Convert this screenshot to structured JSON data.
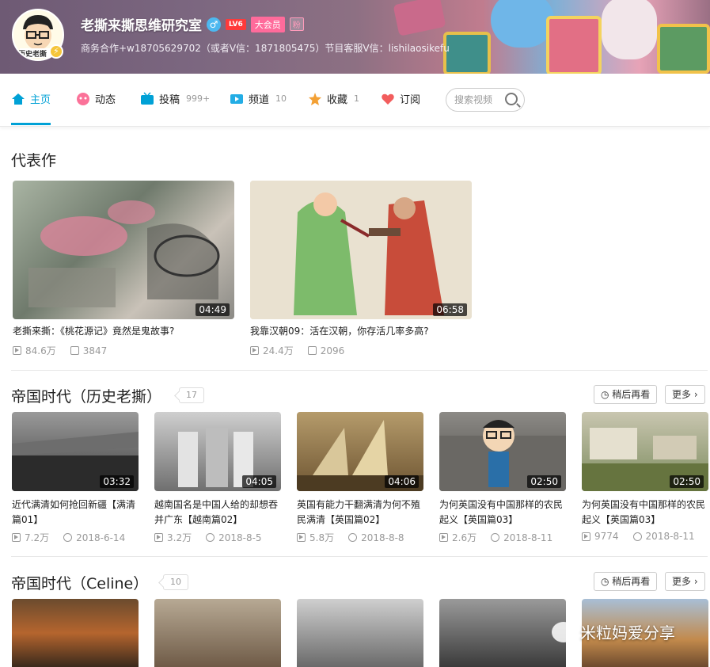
{
  "header": {
    "username": "老撕来撕思维研究室",
    "gender_glyph": "♂",
    "level": "LV6",
    "vip": "大会员",
    "fan_badge": "粉",
    "avatar_caption": "历史老撕",
    "signature": "商务合作+w18705629702（或者V信：1871805475）节目客服V信：lishilaosikefu"
  },
  "nav": {
    "items": [
      {
        "label": "主页",
        "count": "",
        "icon": "home-icon",
        "active": true
      },
      {
        "label": "动态",
        "count": "",
        "icon": "dynamic-icon"
      },
      {
        "label": "投稿",
        "count": "999+",
        "icon": "tv-icon"
      },
      {
        "label": "频道",
        "count": "10",
        "icon": "channel-icon"
      },
      {
        "label": "收藏",
        "count": "1",
        "icon": "star-icon"
      },
      {
        "label": "订阅",
        "count": "",
        "icon": "heart-icon"
      }
    ],
    "search_placeholder": "搜索视频"
  },
  "featured": {
    "title": "代表作",
    "videos": [
      {
        "title": "老撕来撕：《桃花源记》竟然是鬼故事?",
        "duration": "04:49",
        "views": "84.6万",
        "comments": "3847"
      },
      {
        "title": "我靠汉朝09：活在汉朝，你存活几率多高?",
        "duration": "06:58",
        "views": "24.4万",
        "comments": "2096"
      }
    ]
  },
  "channel1": {
    "title": "帝国时代（历史老撕）",
    "count": "17",
    "watch_later": "稍后再看",
    "more": "更多",
    "videos": [
      {
        "title_l1": "近代满清如何抢回新疆【满清",
        "title_l2": "篇01】",
        "duration": "03:32",
        "views": "7.2万",
        "date": "2018-6-14"
      },
      {
        "title_l1": "越南国名是中国人给的却想吞",
        "title_l2": "并广东【越南篇02】",
        "duration": "04:05",
        "views": "3.2万",
        "date": "2018-8-5"
      },
      {
        "title_l1": "英国有能力干翻满清为何不殖",
        "title_l2": "民满清【英国篇02】",
        "duration": "04:06",
        "views": "5.8万",
        "date": "2018-8-8"
      },
      {
        "title_l1": "为何英国没有中国那样的农民",
        "title_l2": "起义【英国篇03】",
        "duration": "02:50",
        "views": "2.6万",
        "date": "2018-8-11"
      },
      {
        "title_l1": "为何英国没有中国那样的农民",
        "title_l2": "起义【英国篇03】",
        "duration": "02:50",
        "views": "9774",
        "date": "2018-8-11"
      }
    ]
  },
  "channel2": {
    "title": "帝国时代（Celine）",
    "count": "10",
    "watch_later": "稍后再看",
    "more": "更多"
  },
  "watermark": "米粒妈爱分享",
  "colors": {
    "accent": "#00a1d6",
    "level": "#ff3a3a",
    "vip": "#ff6b9b"
  }
}
